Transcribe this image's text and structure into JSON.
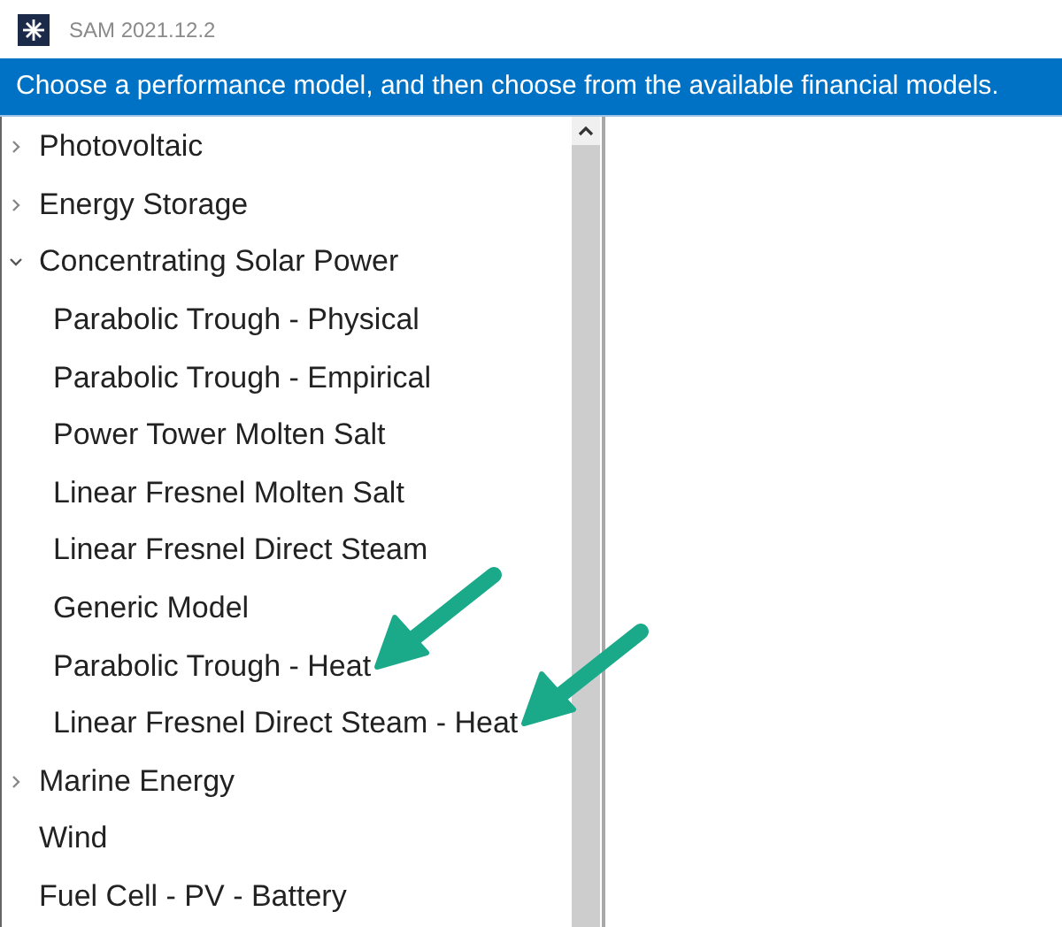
{
  "window": {
    "title": "SAM 2021.12.2"
  },
  "banner": {
    "text": "Choose a performance model, and then choose from the available financial models."
  },
  "tree": [
    {
      "label": "Photovoltaic",
      "expanded": false
    },
    {
      "label": "Energy Storage",
      "expanded": false
    },
    {
      "label": "Concentrating Solar Power",
      "expanded": true,
      "children": [
        {
          "label": "Parabolic Trough - Physical",
          "pointed": false
        },
        {
          "label": "Parabolic Trough - Empirical",
          "pointed": false
        },
        {
          "label": "Power Tower Molten Salt",
          "pointed": false
        },
        {
          "label": "Linear Fresnel Molten Salt",
          "pointed": false
        },
        {
          "label": "Linear Fresnel Direct Steam",
          "pointed": false
        },
        {
          "label": "Generic Model",
          "pointed": false
        },
        {
          "label": "Parabolic Trough - Heat",
          "pointed": true
        },
        {
          "label": "Linear Fresnel Direct Steam - Heat",
          "pointed": true
        }
      ]
    },
    {
      "label": "Marine Energy",
      "expanded": false
    },
    {
      "label": "Wind"
    },
    {
      "label": "Fuel Cell - PV - Battery"
    }
  ]
}
